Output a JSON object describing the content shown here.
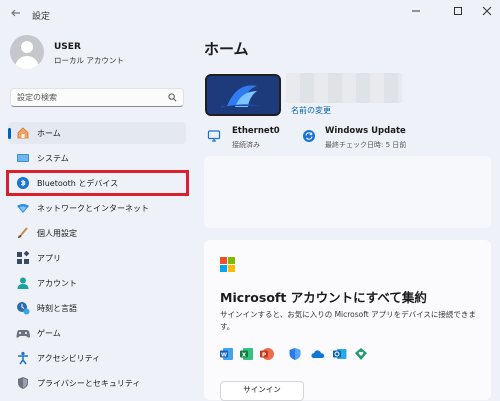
{
  "window": {
    "title": "設定",
    "back_icon": "back-arrow-icon"
  },
  "profile": {
    "name": "USER",
    "account_type": "ローカル アカウント"
  },
  "search": {
    "placeholder": "設定の検索"
  },
  "sidebar": {
    "items": [
      {
        "label": "ホーム",
        "icon": "home-icon",
        "active": true
      },
      {
        "label": "システム",
        "icon": "system-icon"
      },
      {
        "label": "Bluetooth とデバイス",
        "icon": "bluetooth-icon",
        "highlighted": true
      },
      {
        "label": "ネットワークとインターネット",
        "icon": "network-icon"
      },
      {
        "label": "個人用設定",
        "icon": "personalization-icon"
      },
      {
        "label": "アプリ",
        "icon": "apps-icon"
      },
      {
        "label": "アカウント",
        "icon": "accounts-icon"
      },
      {
        "label": "時刻と言語",
        "icon": "time-language-icon"
      },
      {
        "label": "ゲーム",
        "icon": "gaming-icon"
      },
      {
        "label": "アクセシビリティ",
        "icon": "accessibility-icon"
      },
      {
        "label": "プライバシーとセキュリティ",
        "icon": "privacy-icon"
      }
    ]
  },
  "main": {
    "title": "ホーム",
    "device": {
      "rename_label": "名前の変更"
    },
    "network": {
      "name": "Ethernet0",
      "status": "接続済み"
    },
    "update": {
      "name": "Windows Update",
      "status": "最終チェック日時: 5 日前"
    },
    "account_card": {
      "title": "Microsoft アカウントにすべて集約",
      "description": "サインインすると、お気に入りの Microsoft アプリをデバイスに接続できます。",
      "signin_label": "サインイン",
      "apps": [
        "word-icon",
        "excel-icon",
        "powerpoint-icon",
        "defender-icon",
        "onedrive-icon",
        "outlook-icon",
        "family-icon"
      ]
    }
  },
  "colors": {
    "accent": "#005fb8",
    "highlight": "#d9202d",
    "link": "#0063b1"
  }
}
